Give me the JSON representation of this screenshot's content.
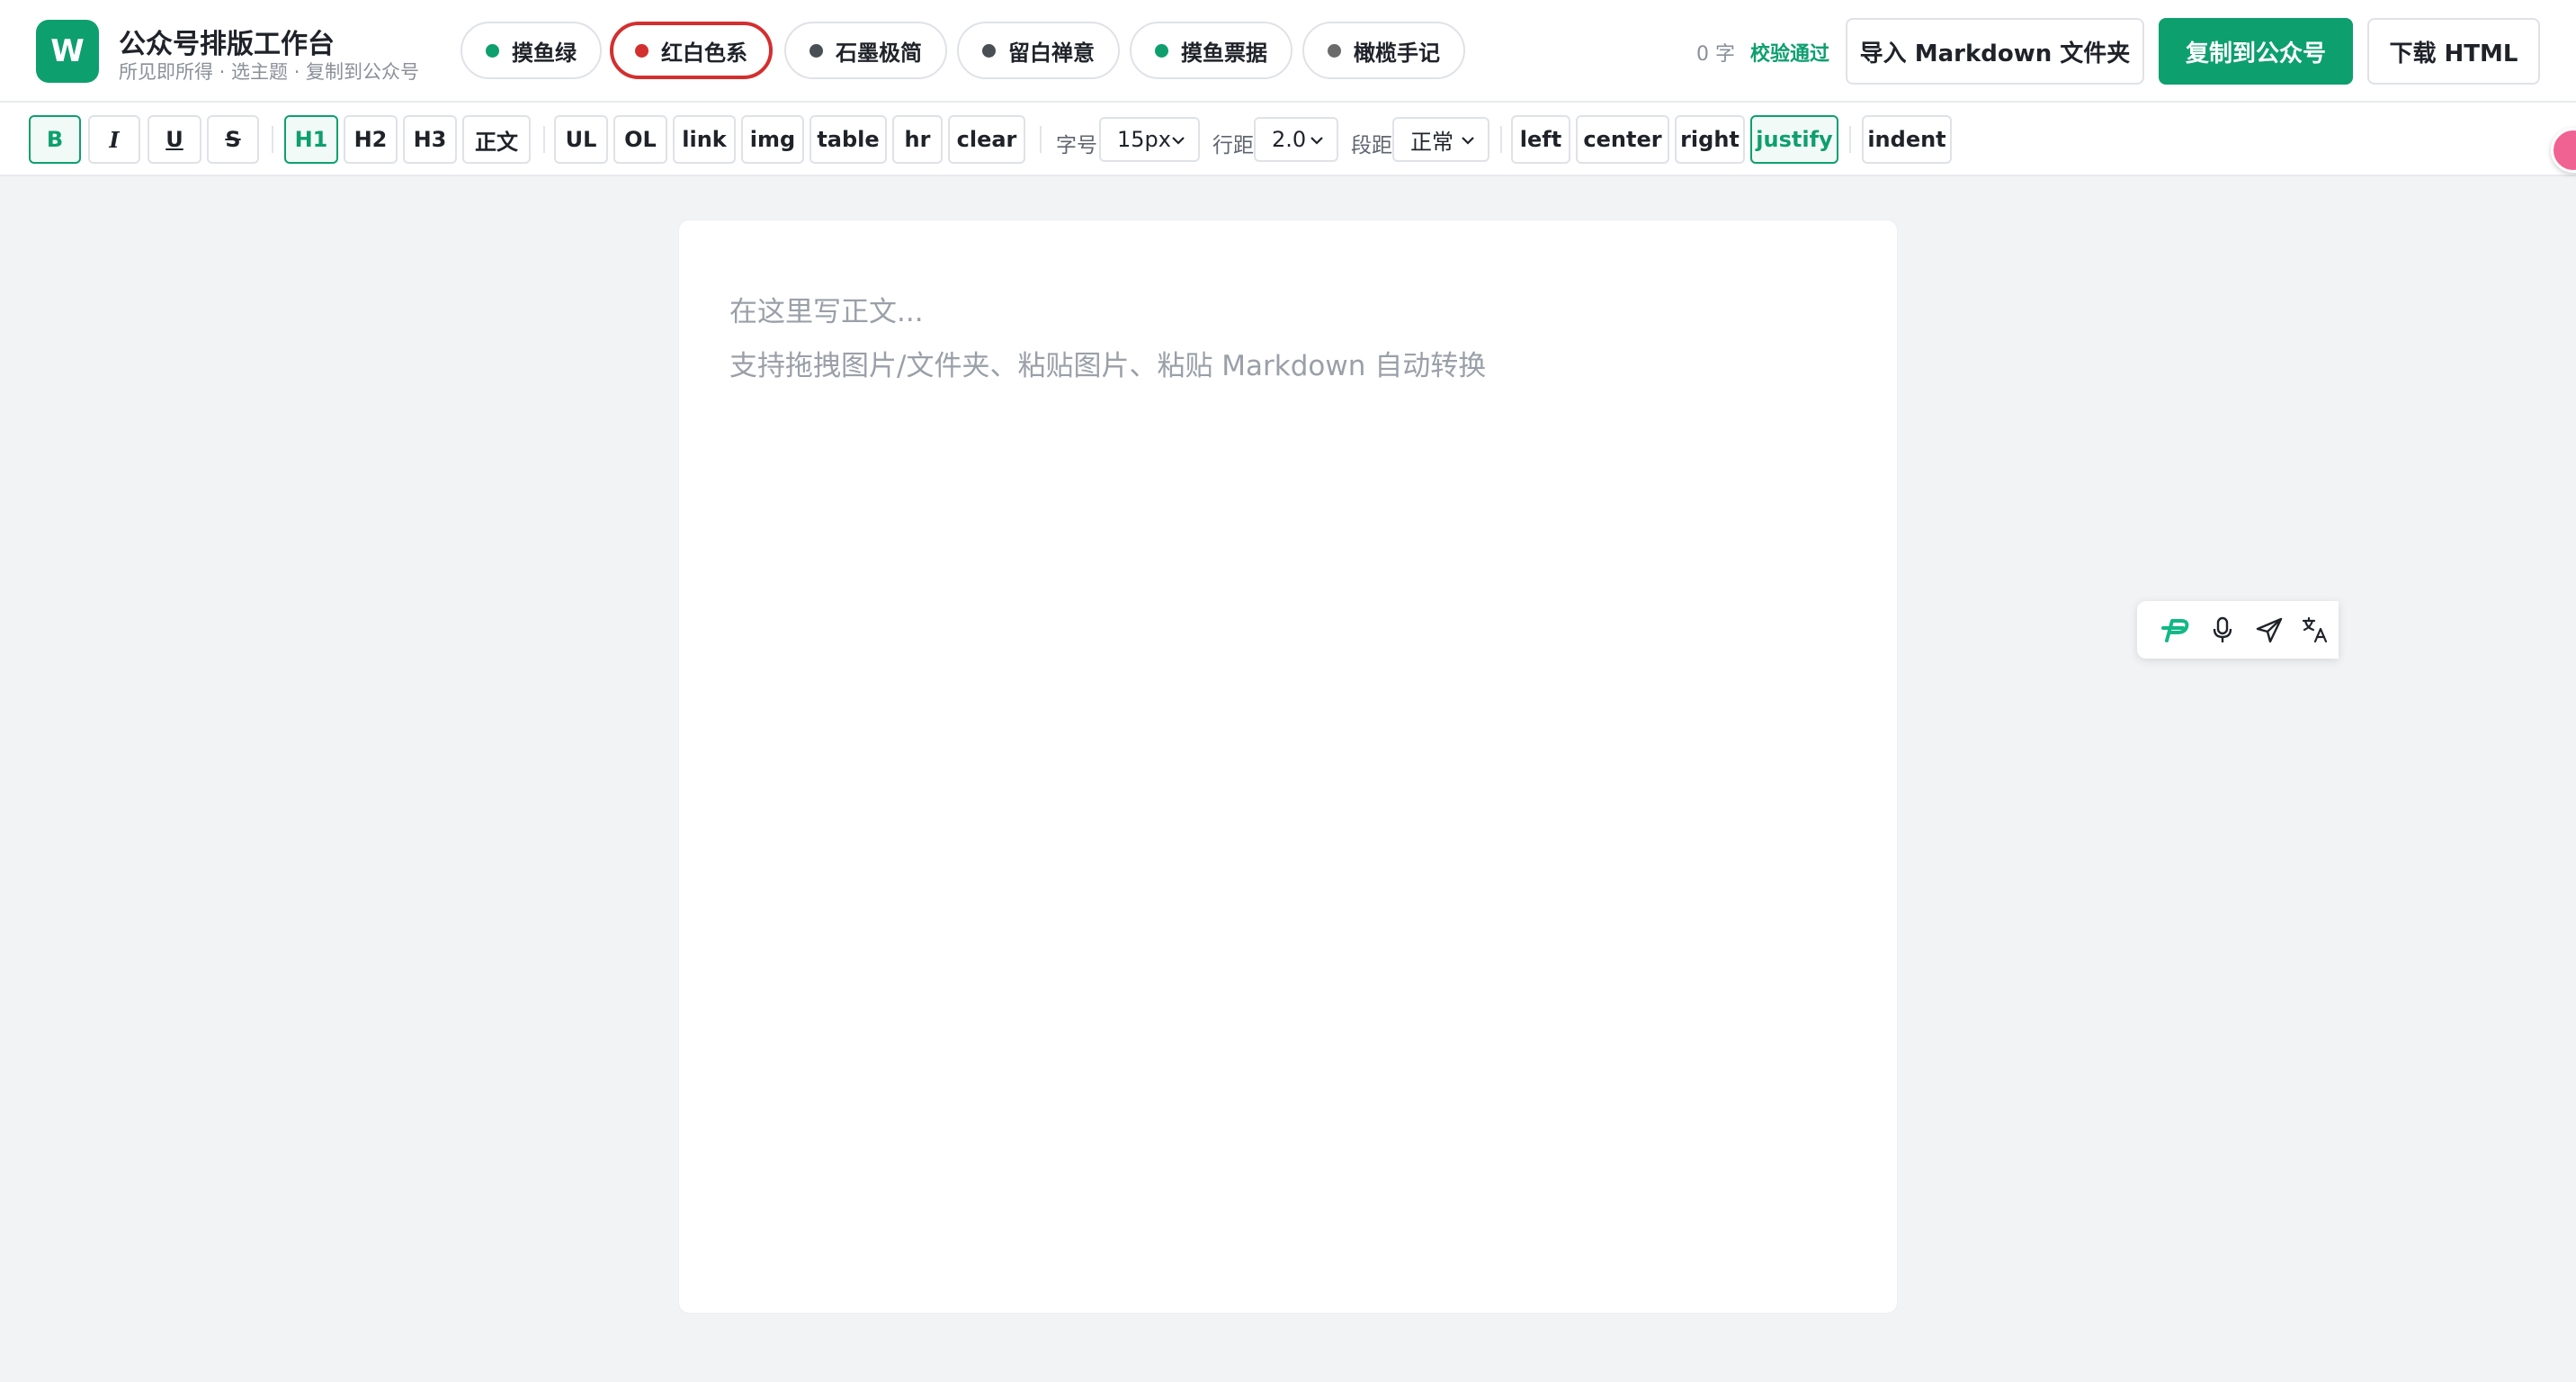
{
  "header": {
    "logo_letter": "W",
    "title": "公众号排版工作台",
    "subtitle": "所见即所得 · 选主题 · 复制到公众号",
    "themes": [
      {
        "label": "摸鱼绿",
        "color": "#0e9f6e",
        "active": false
      },
      {
        "label": "红白色系",
        "color": "#d32f2f",
        "active": true
      },
      {
        "label": "石墨极简",
        "color": "#4a4f55",
        "active": false
      },
      {
        "label": "留白禅意",
        "color": "#4a4f55",
        "active": false
      },
      {
        "label": "摸鱼票据",
        "color": "#0e9f6e",
        "active": false
      },
      {
        "label": "橄榄手记",
        "color": "#6b6b6b",
        "active": false
      }
    ],
    "word_count": "0 字",
    "verify_status": "校验通过",
    "import_label": "导入 Markdown 文件夹",
    "copy_label": "复制到公众号",
    "download_label": "下载 HTML"
  },
  "toolbar": {
    "bold": "B",
    "italic": "I",
    "underline": "U",
    "strike": "S",
    "h1": "H1",
    "h2": "H2",
    "h3": "H3",
    "body": "正文",
    "ul": "UL",
    "ol": "OL",
    "link": "link",
    "img": "img",
    "table": "table",
    "hr": "hr",
    "clear": "clear",
    "font_size_label": "字号",
    "font_size_value": "15px",
    "line_height_label": "行距",
    "line_height_value": "2.0",
    "paragraph_label": "段距",
    "paragraph_value": "正常",
    "align_left": "left",
    "align_center": "center",
    "align_right": "right",
    "align_justify": "justify",
    "indent": "indent"
  },
  "editor": {
    "placeholder_line1": "在这里写正文...",
    "placeholder_line2": "支持拖拽图片/文件夹、粘贴图片、粘贴 Markdown 自动转换"
  },
  "colors": {
    "brand": "#0e9f6e",
    "active_theme": "#d32f2f",
    "background": "#f2f3f5"
  }
}
